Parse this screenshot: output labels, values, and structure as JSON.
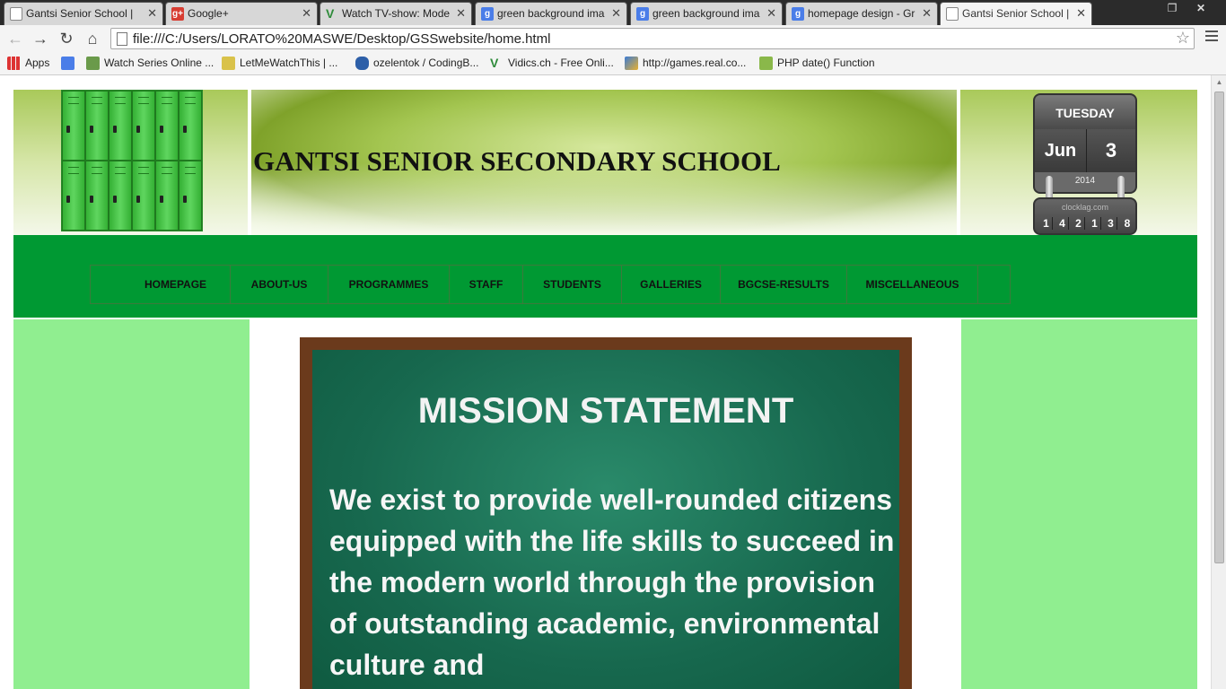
{
  "browser": {
    "tabs": [
      {
        "label": "Gantsi Senior School |",
        "icon": "page-icon"
      },
      {
        "label": "Google+",
        "icon": "google-plus-icon"
      },
      {
        "label": "Watch TV-show: Mode",
        "icon": "v-icon"
      },
      {
        "label": "green background ima",
        "icon": "google-icon"
      },
      {
        "label": "green background ima",
        "icon": "google-icon"
      },
      {
        "label": "homepage design - Gr",
        "icon": "google-icon"
      },
      {
        "label": "Gantsi Senior School |",
        "icon": "page-icon"
      }
    ],
    "close_glyph": "✕",
    "address": "file:///C:/Users/LORATO%20MASWE/Desktop/GSSwebsite/home.html",
    "bookmarks": [
      {
        "label": "Apps"
      },
      {
        "label": ""
      },
      {
        "label": "Watch Series Online ..."
      },
      {
        "label": "LetMeWatchThis | ..."
      },
      {
        "label": "ozelentok / CodingB..."
      },
      {
        "label": "Vidics.ch - Free Onli..."
      },
      {
        "label": "http://games.real.co..."
      },
      {
        "label": "PHP date() Function"
      }
    ]
  },
  "site": {
    "title": "GANTSI SENIOR SECONDARY SCHOOL",
    "nav": [
      "HOMEPAGE",
      "ABOUT-US",
      "PROGRAMMES",
      "STAFF",
      "STUDENTS",
      "GALLERIES",
      "BGCSE-RESULTS",
      "MISCELLANEOUS"
    ],
    "clock": {
      "day": "TUESDAY",
      "month": "Jun",
      "date": "3",
      "year": "2014",
      "brand": "clocklag.com",
      "digits": [
        "1",
        "4",
        "2",
        "1",
        "3",
        "8"
      ]
    },
    "mission": {
      "title": "MISSION STATEMENT",
      "text": "We exist to provide well-rounded citizens equipped with the life skills to succeed in the modern world through the provision of outstanding academic, environmental culture and"
    }
  },
  "colors": {
    "nav_band": "#009933",
    "side_panels": "#90ee90",
    "chalkboard": "#17684e"
  }
}
